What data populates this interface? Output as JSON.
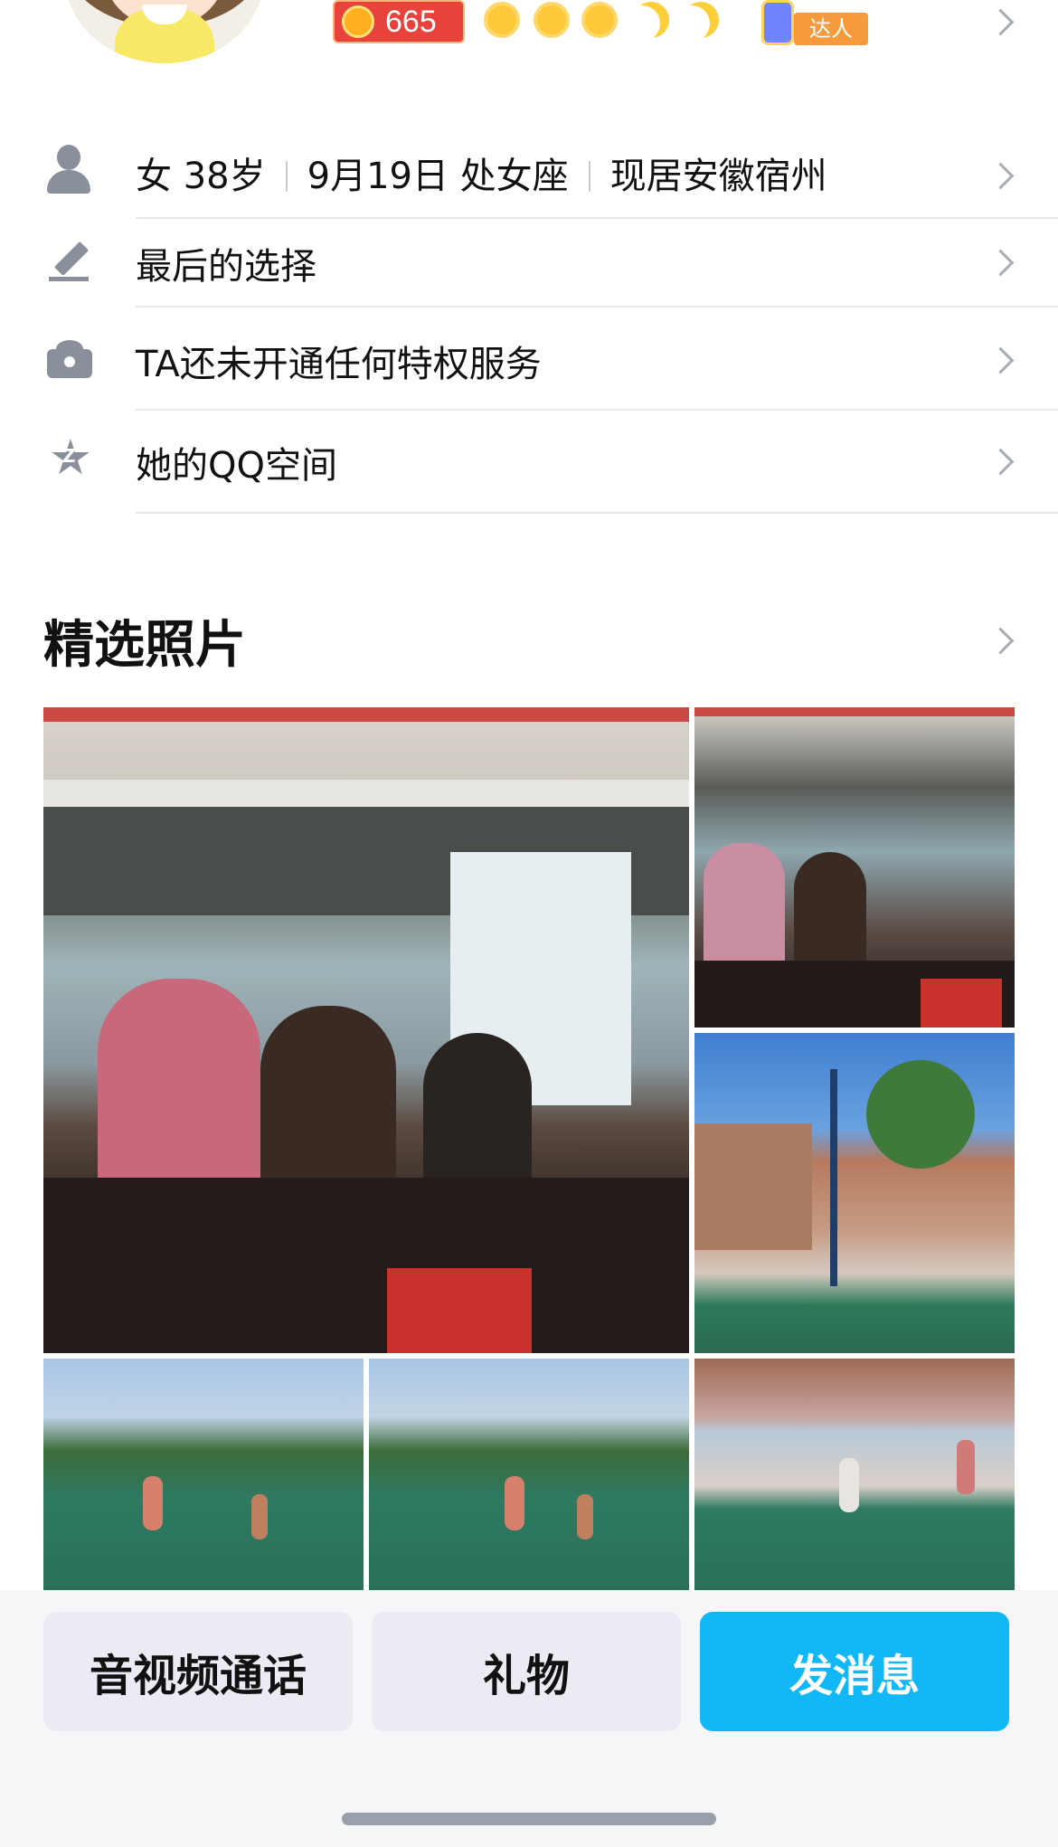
{
  "header": {
    "level_number": "665",
    "level_icons": [
      "sun-icon",
      "sun-icon",
      "sun-icon",
      "moon-icon",
      "moon-icon"
    ],
    "badge_label": "达人"
  },
  "info_rows": {
    "profile": {
      "gender_age": "女 38岁",
      "birthday": "9月19日 处女座",
      "location": "现居安徽宿州"
    },
    "signature": "最后的选择",
    "privilege": "TA还未开通任何特权服务",
    "qzone": "她的QQ空间"
  },
  "photos": {
    "section_title": "精选照片"
  },
  "actions": {
    "call_label": "音视频通话",
    "gift_label": "礼物",
    "message_label": "发消息"
  },
  "colors": {
    "accent": "#12b7f5",
    "secondary_button": "#ebecf3",
    "icon_gray": "#8a8f9c"
  }
}
